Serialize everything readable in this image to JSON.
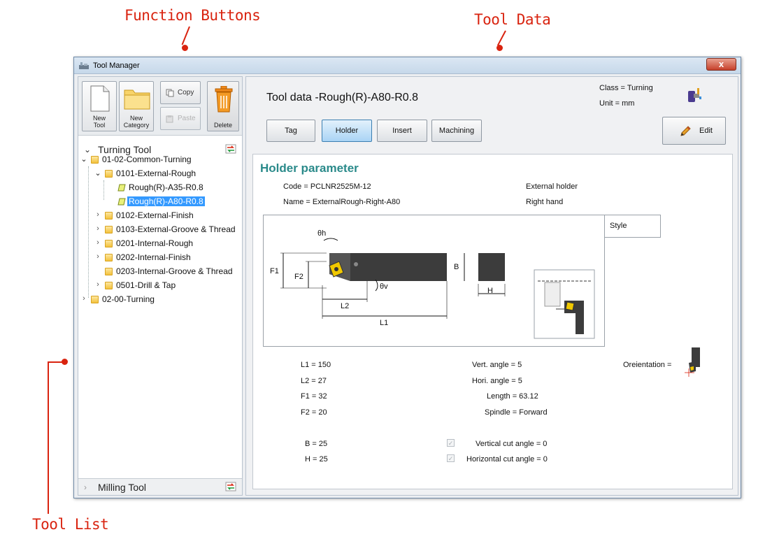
{
  "annotations": {
    "function_buttons": "Function Buttons",
    "tool_data": "Tool Data",
    "tool_list": "Tool List"
  },
  "window": {
    "title": "Tool Manager",
    "close_glyph": "x"
  },
  "toolbar": {
    "new_tool_label_1": "New",
    "new_tool_label_2": "Tool",
    "new_category_label_1": "New",
    "new_category_label_2": "Category",
    "copy_label": "Copy",
    "paste_label": "Paste",
    "delete_label": "Delete"
  },
  "tree": {
    "turning_header": "Turning Tool",
    "milling_header": "Milling Tool",
    "nodes": [
      {
        "label": "01-02-Common-Turning"
      },
      {
        "label": "0101-External-Rough"
      },
      {
        "label": "Rough(R)-A35-R0.8"
      },
      {
        "label": "Rough(R)-A80-R0.8"
      },
      {
        "label": "0102-External-Finish"
      },
      {
        "label": "0103-External-Groove & Thread"
      },
      {
        "label": "0201-Internal-Rough"
      },
      {
        "label": "0202-Internal-Finish"
      },
      {
        "label": "0203-Internal-Groove & Thread"
      },
      {
        "label": "0501-Drill & Tap"
      },
      {
        "label": "02-00-Turning"
      }
    ]
  },
  "tool_data": {
    "title": "Tool data -Rough(R)-A80-R0.8",
    "class": "Class = Turning",
    "unit": "Unit = mm",
    "edit_label": "Edit",
    "tabs": [
      "Tag",
      "Holder",
      "Insert",
      "Machining"
    ],
    "active_tab": "Holder"
  },
  "holder": {
    "heading": "Holder parameter",
    "code": "Code = PCLNR2525M-12",
    "name": "Name = ExternalRough-Right-A80",
    "holder_type": "External holder",
    "hand": "Right hand",
    "style_label": "Style",
    "orientation_label": "Oreientation =",
    "diagram_labels": {
      "theta_h": "θh",
      "theta_v": "θv",
      "F1": "F1",
      "F2": "F2",
      "B": "B",
      "H": "H",
      "L1": "L1",
      "L2": "L2"
    },
    "params": {
      "L1": "L1 = 150",
      "L2": "L2 = 27",
      "F1": "F1 = 32",
      "F2": "F2 = 20",
      "B": "B = 25",
      "H": "H = 25",
      "vert_angle": "Vert. angle = 5",
      "hori_angle": "Hori. angle = 5",
      "length": "Length = 63.12",
      "spindle": "Spindle = Forward",
      "vertical_cut_angle": "Vertical cut angle = 0",
      "horizontal_cut_angle": "Horizontal cut angle = 0"
    }
  },
  "colors": {
    "callout_red": "#d9230f",
    "heading_teal": "#2a8a8a",
    "selection_blue": "#3399ff",
    "active_tab_blue": "#a9d4f5",
    "tool_body_dark": "#3c3c3c",
    "insert_yellow": "#f0c800"
  }
}
